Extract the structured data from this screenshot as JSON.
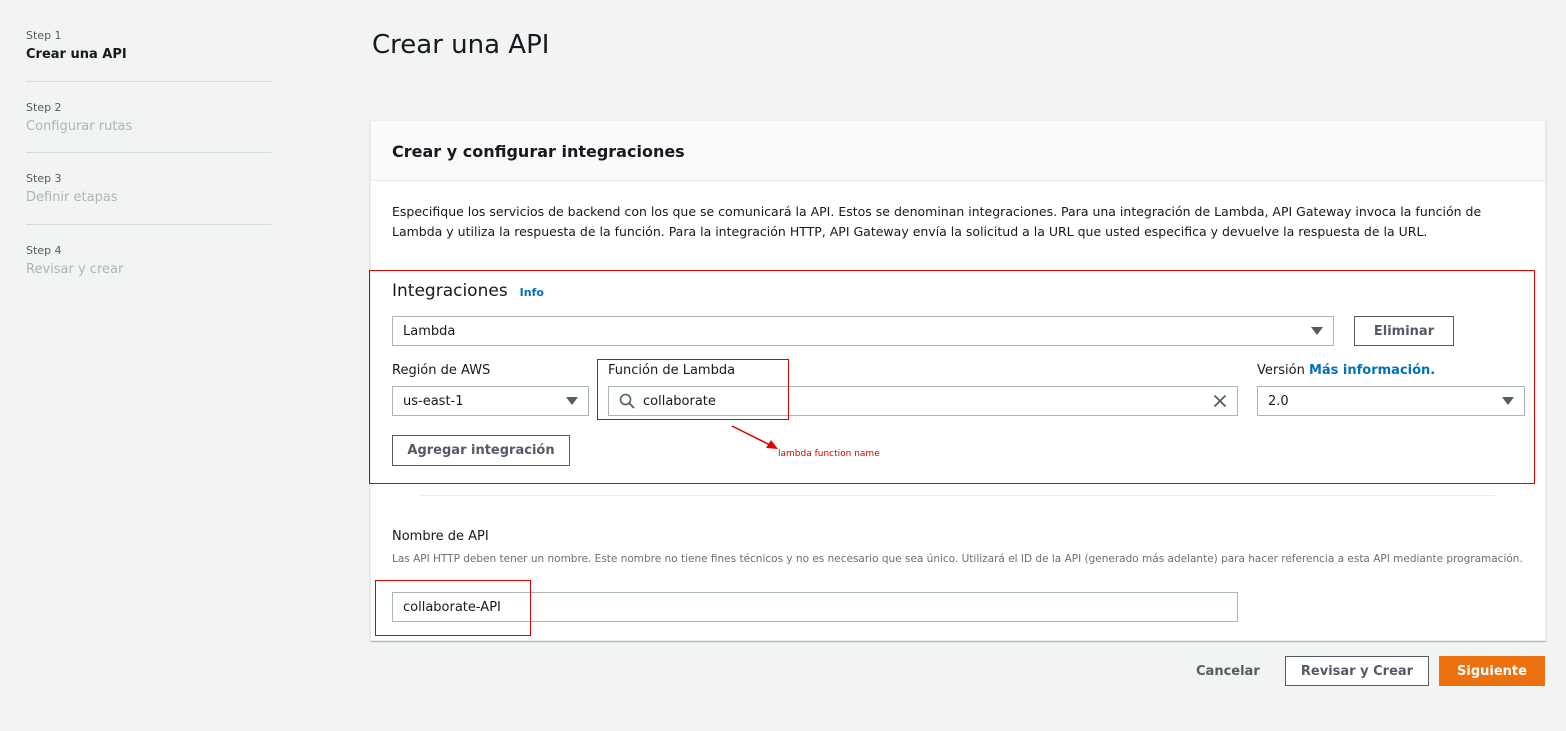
{
  "sidebar": {
    "steps": [
      {
        "num": "Step 1",
        "label": "Crear una API"
      },
      {
        "num": "Step 2",
        "label": "Configurar rutas"
      },
      {
        "num": "Step 3",
        "label": "Definir etapas"
      },
      {
        "num": "Step 4",
        "label": "Revisar y crear"
      }
    ]
  },
  "page_title": "Crear una API",
  "card": {
    "title": "Crear y configurar integraciones",
    "description": "Especifique los servicios de backend con los que se comunicará la API. Estos se denominan integraciones. Para una integración de Lambda, API Gateway invoca la función de Lambda y utiliza la respuesta de la función. Para la integración HTTP, API Gateway envía la solicitud a la URL que usted especifica y devuelve la respuesta de la URL."
  },
  "integrations": {
    "heading": "Integraciones",
    "info_link": "Info",
    "type_value": "Lambda",
    "delete_label": "Eliminar",
    "region_label": "Región de AWS",
    "region_value": "us-east-1",
    "function_label": "Función de Lambda",
    "function_value": "collaborate",
    "version_label": "Versión",
    "version_more": "Más información.",
    "version_value": "2.0",
    "add_label": "Agregar integración"
  },
  "annotation": "lambda function name",
  "api_name": {
    "label": "Nombre de API",
    "hint": "Las API HTTP deben tener un nombre. Este nombre no tiene fines técnicos y no es necesario que sea único. Utilizará el ID de la API (generado más adelante) para hacer referencia a esta API mediante programación.",
    "value": "collaborate-API"
  },
  "footer": {
    "cancel": "Cancelar",
    "review": "Revisar y Crear",
    "next": "Siguiente"
  },
  "colors": {
    "primary": "#ec7211",
    "link": "#0073bb",
    "annotation_red": "#e00000"
  }
}
